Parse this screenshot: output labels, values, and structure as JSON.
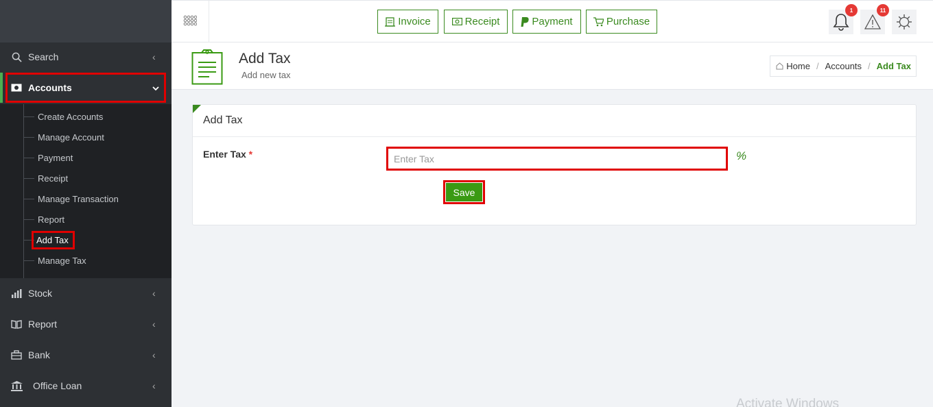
{
  "sidebar": {
    "items": [
      {
        "label": "Search"
      },
      {
        "label": "Accounts"
      },
      {
        "label": "Stock"
      },
      {
        "label": "Report"
      },
      {
        "label": "Bank"
      },
      {
        "label": "Office Loan"
      }
    ],
    "submenu": [
      {
        "label": "Create Accounts"
      },
      {
        "label": "Manage Account"
      },
      {
        "label": "Payment"
      },
      {
        "label": "Receipt"
      },
      {
        "label": "Manage Transaction"
      },
      {
        "label": "Report"
      },
      {
        "label": "Add Tax"
      },
      {
        "label": "Manage Tax"
      }
    ]
  },
  "topbar": {
    "quick_buttons": [
      {
        "label": "Invoice"
      },
      {
        "label": "Receipt"
      },
      {
        "label": "Payment"
      },
      {
        "label": "Purchase"
      }
    ],
    "notifications_count": "1",
    "alerts_count": "11"
  },
  "header": {
    "title": "Add Tax",
    "subtitle": "Add new tax",
    "breadcrumb": [
      "Home",
      "Accounts",
      "Add Tax"
    ]
  },
  "card": {
    "title": "Add Tax",
    "field_label": "Enter Tax",
    "required_mark": "*",
    "input_placeholder": "Enter Tax",
    "input_value": "",
    "unit": "%",
    "save_label": "Save"
  },
  "watermark": "Activate Windows",
  "colors": {
    "accent": "#3a8a1f",
    "sidebar": "#2d3034",
    "highlight": "#e00000"
  }
}
